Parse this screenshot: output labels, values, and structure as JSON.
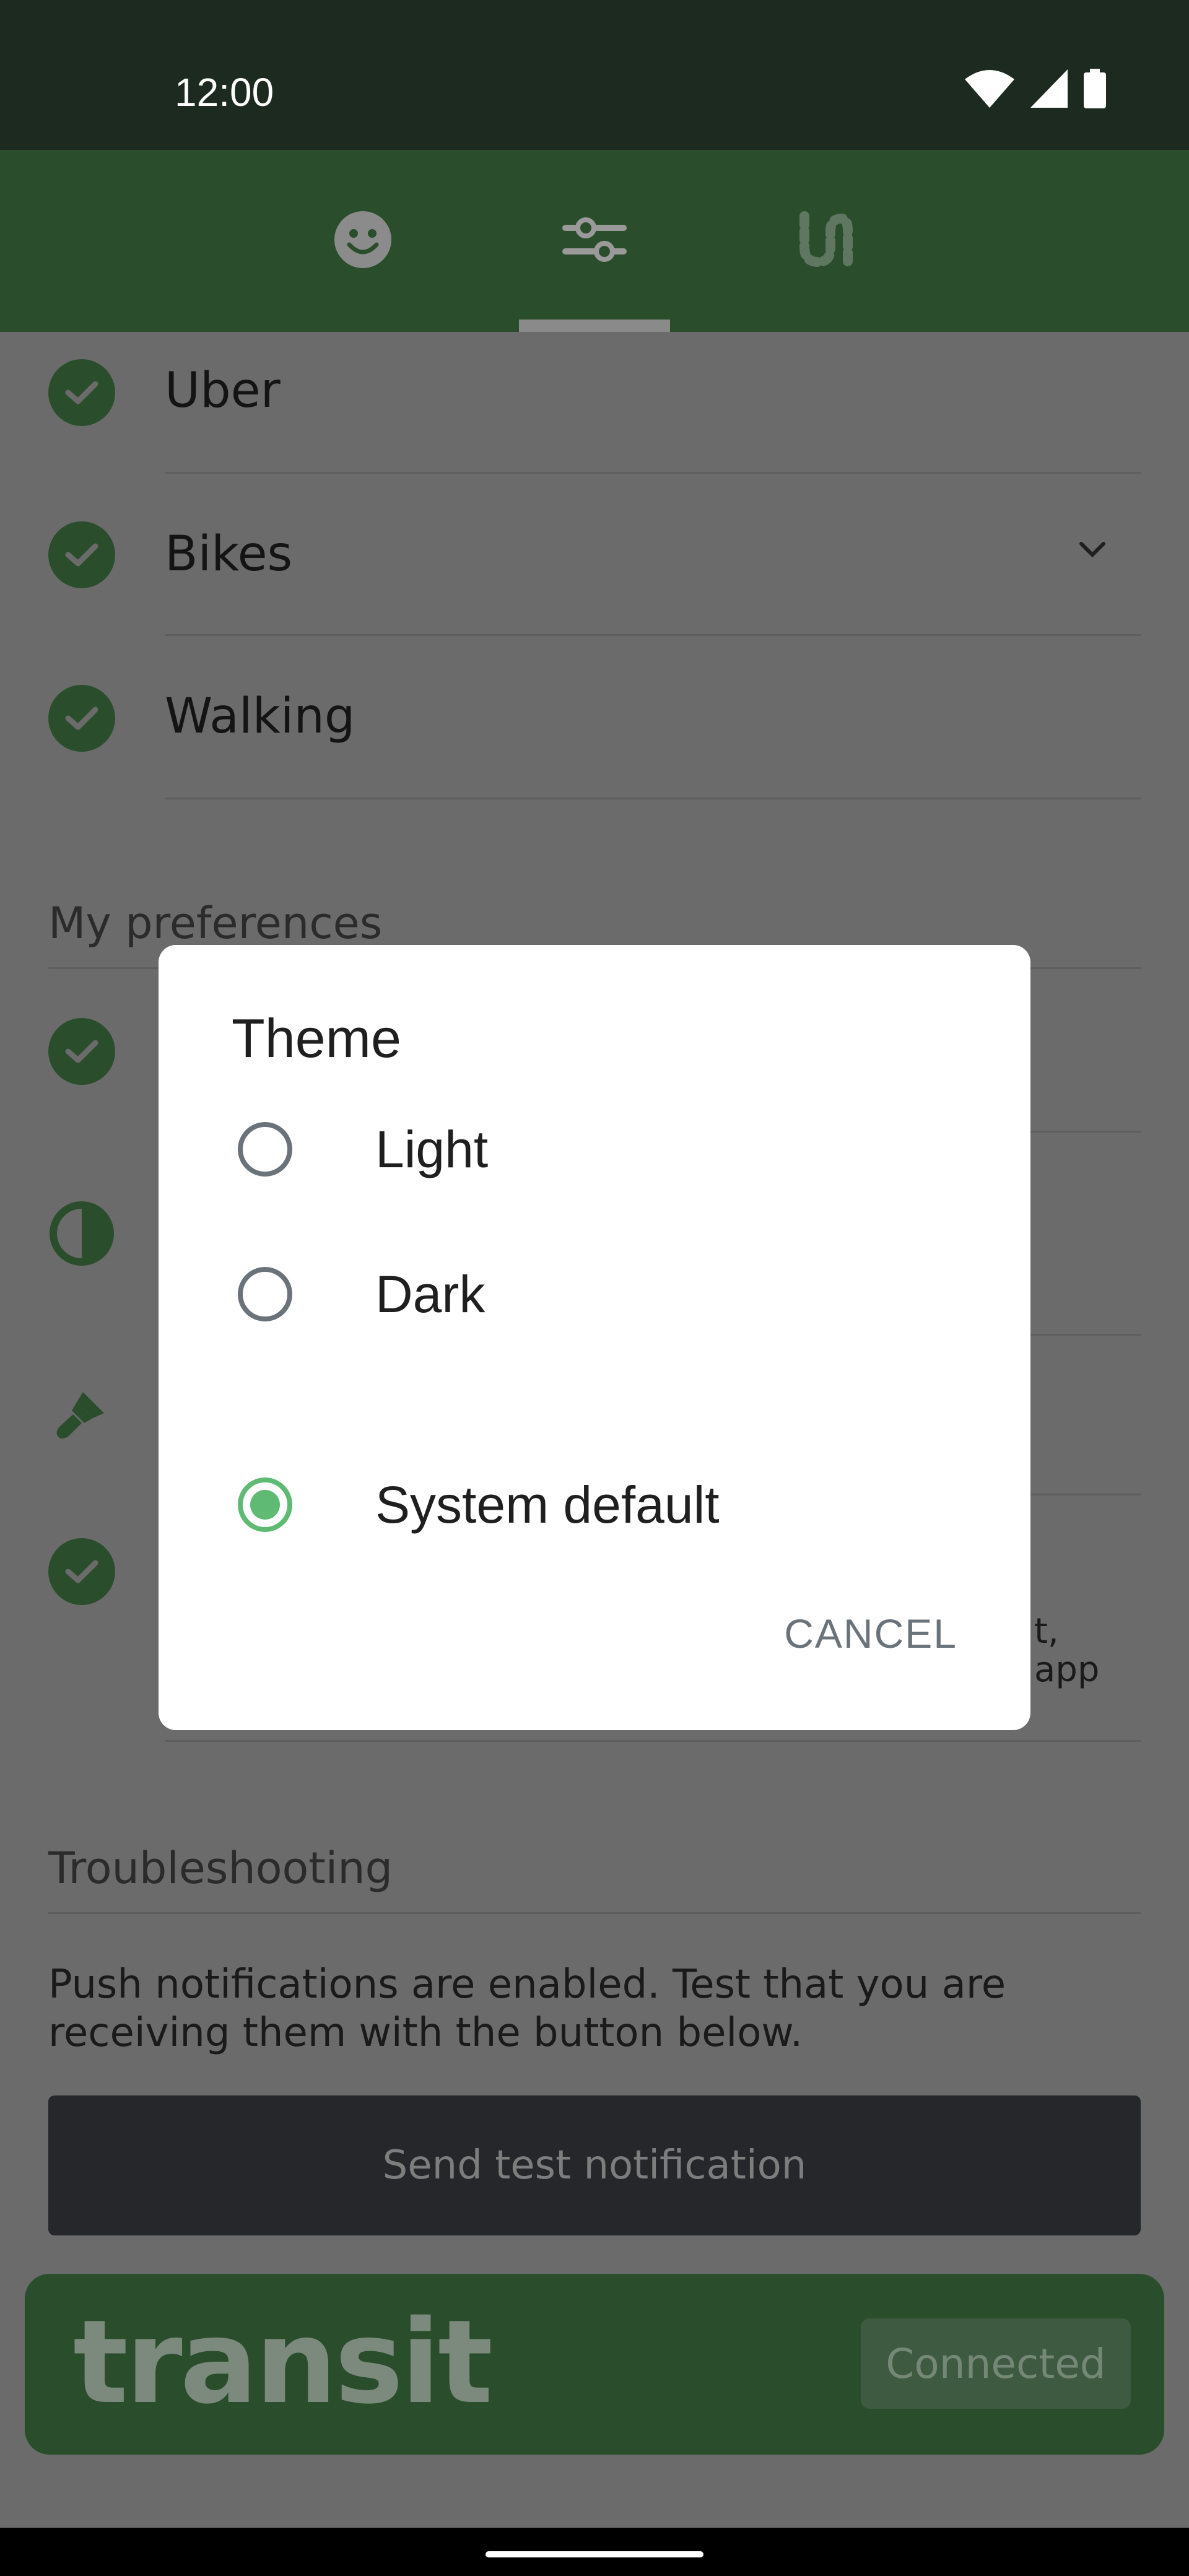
{
  "status_bar": {
    "time": "12:00",
    "icons": [
      "wifi-icon",
      "cellular-signal-icon",
      "battery-icon"
    ]
  },
  "tabs": [
    {
      "icon": "smiley-icon"
    },
    {
      "icon": "sliders-icon",
      "selected": true
    },
    {
      "icon": "route-icon"
    }
  ],
  "transport_rows": [
    {
      "label": "Uber",
      "icon": "check-circle-icon"
    },
    {
      "label": "Bikes",
      "icon": "check-circle-icon",
      "has_dropdown": true
    },
    {
      "label": "Walking",
      "icon": "check-circle-icon"
    }
  ],
  "preferences": {
    "title": "My preferences",
    "row_icons": [
      "check-circle-icon",
      "contrast-icon",
      "paint-brush-icon",
      "check-circle-icon"
    ],
    "partial_text": "t,\napp"
  },
  "troubleshooting": {
    "title": "Troubleshooting",
    "text": "Push notifications are enabled. Test that you are receiving them with the button below.",
    "button_label": "Send test notification"
  },
  "transit_card": {
    "logo_text": "transit",
    "badge_label": "Connected"
  },
  "theme_dialog": {
    "title": "Theme",
    "options": [
      {
        "label": "Light",
        "selected": false
      },
      {
        "label": "Dark",
        "selected": false
      },
      {
        "label": "System default",
        "selected": true
      }
    ],
    "cancel_label": "CANCEL"
  },
  "colors": {
    "brand_green": "#2a4e2c",
    "accent_green": "#5fba74",
    "status_bar": "#1c2a1f"
  }
}
